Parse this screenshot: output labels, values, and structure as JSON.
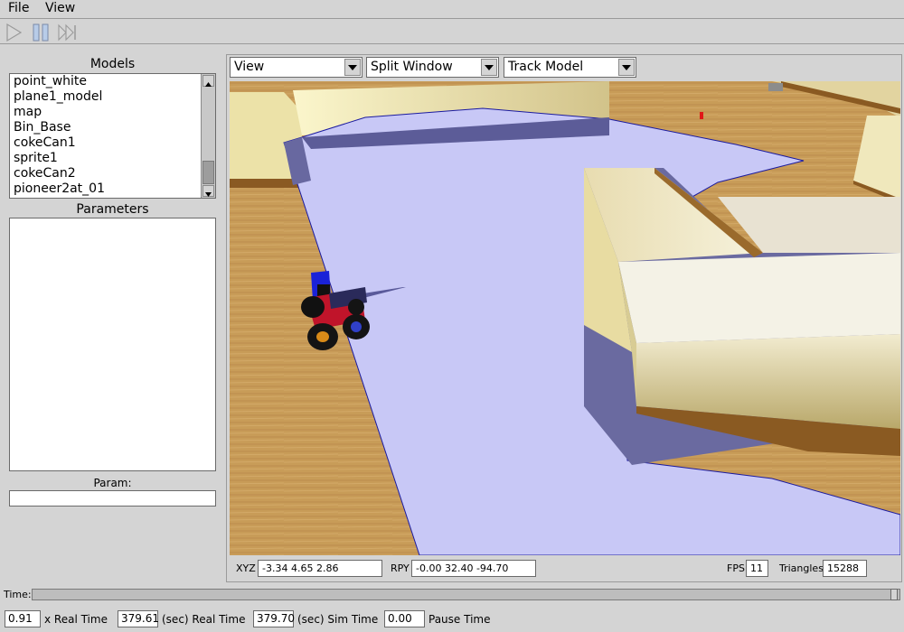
{
  "menu": {
    "file": "File",
    "view": "View"
  },
  "toolbar": {
    "play_icon": "play-icon",
    "pause_icon": "pause-icon",
    "step_icon": "step-icon"
  },
  "models": {
    "title": "Models",
    "items": [
      "point_white",
      "plane1_model",
      "map",
      "Bin_Base",
      "cokeCan1",
      "sprite1",
      "cokeCan2",
      "pioneer2at_01"
    ]
  },
  "parameters": {
    "title": "Parameters",
    "param_label": "Param:",
    "param_value": ""
  },
  "viewport": {
    "view_select": "View",
    "split_select": "Split Window",
    "track_select": "Track Model",
    "xyz_label": "XYZ",
    "xyz_value": "-3.34   4.65   2.86",
    "rpy_label": "RPY",
    "rpy_value": "-0.00  32.40 -94.70",
    "fps_label": "FPS",
    "fps_value": "11",
    "triangles_label": "Triangles",
    "triangles_value": "15288"
  },
  "time": {
    "label": "Time:",
    "real_time_factor": "0.91",
    "real_time_factor_label": "x Real Time",
    "real_time": "379.61",
    "real_time_label": "(sec) Real Time",
    "sim_time": "379.70",
    "sim_time_label": "(sec) Sim Time",
    "pause_time": "0.00",
    "pause_time_label": "Pause Time"
  },
  "colors": {
    "floor": "#c79b56",
    "laser": "#c8c8f8",
    "laser_shadow": "#6f6fa8",
    "wall_top": "#f4f0c6",
    "wall_side": "#c9ba7e",
    "robot_body": "#c0142a",
    "robot_top": "#1a22d8"
  }
}
